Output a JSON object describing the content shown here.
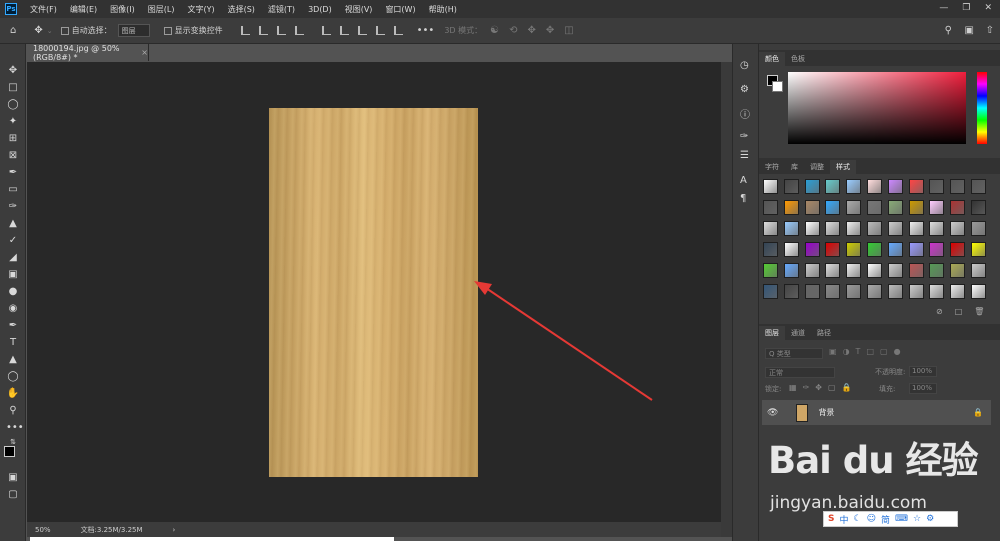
{
  "app": {
    "logo": "Ps",
    "menu": [
      "文件(F)",
      "编辑(E)",
      "图像(I)",
      "图层(L)",
      "文字(Y)",
      "选择(S)",
      "滤镜(T)",
      "3D(D)",
      "视图(V)",
      "窗口(W)",
      "帮助(H)"
    ],
    "window_controls": [
      "minimize-icon",
      "restore-icon",
      "close-icon"
    ]
  },
  "options_bar": {
    "auto_select_label": "自动选择：",
    "auto_select_value": "图层",
    "show_transform_label": "显示变换控件",
    "mode_3d_label": "3D 模式："
  },
  "document": {
    "tab_title": "18000194.jpg @ 50%(RGB/8#) *",
    "zoom": "50%",
    "doc_info": "文档:3.25M/3.25M",
    "annotation_arrow_color": "#e53935"
  },
  "panels": {
    "color_tabs": [
      "颜色",
      "色板"
    ],
    "styles_tabs": [
      "字符",
      "库",
      "调整",
      "样式"
    ],
    "layers_tabs": [
      "图层",
      "通道",
      "路径"
    ],
    "layers": {
      "filter_placeholder": "Q 类型",
      "blend_mode": "正常",
      "opacity_label": "不透明度:",
      "opacity_value": "100%",
      "lock_label": "锁定:",
      "fill_label": "填充:",
      "fill_value": "100%",
      "items": [
        {
          "name": "背景",
          "visible": true,
          "locked": true
        }
      ]
    }
  },
  "watermark": {
    "main": "Bai du 经验",
    "sub": "jingyan.baidu.com"
  },
  "ime": {
    "items": [
      "中",
      "简"
    ]
  }
}
